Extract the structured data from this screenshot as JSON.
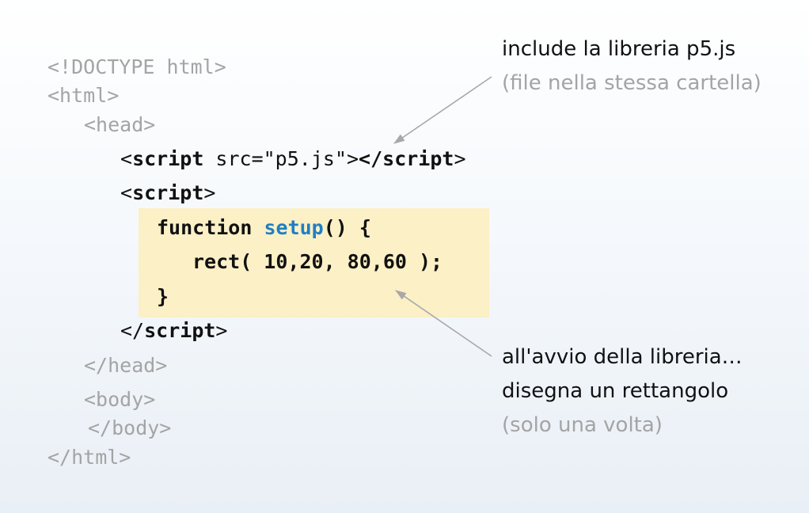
{
  "code": {
    "doctype": "<!DOCTYPE html>",
    "html_open": "<html>",
    "head_open": "<head>",
    "script_src_lt": "<",
    "script_src_tag": "script",
    "script_src_attr": " src=\"p5.js\">",
    "script_src_close": "</script",
    "script_src_gt": ">",
    "script_open_lt": "<",
    "script_open_tag": "script",
    "script_open_gt": ">",
    "func_keyword": "function ",
    "func_name": "setup",
    "func_rest": "() {",
    "rect_call": "rect( 10,20, 80,60 );",
    "brace_close": "}",
    "script_close_lt": "</",
    "script_close_tag": "script",
    "script_close_gt": ">",
    "head_close": "</head>",
    "body_open": "<body>",
    "body_close": "</body>",
    "html_close": "</html>"
  },
  "annotations": {
    "top_main": "include la libreria p5.js",
    "top_sub": "(file nella stessa cartella)",
    "bottom_line1": "all'avvio della libreria…",
    "bottom_line2": "disegna un rettangolo",
    "bottom_sub": "(solo una volta)"
  },
  "colors": {
    "comment_gray": "#a4a4a4",
    "code_dark": "#111111",
    "function_blue": "#1f7fc4",
    "highlight_fill": "#fbf0c6",
    "arrow_gray": "#a8a8a8"
  }
}
